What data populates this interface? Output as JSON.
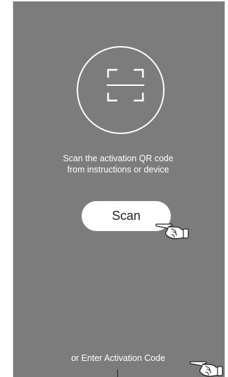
{
  "instructions": {
    "line1": "Scan the activation QR code",
    "line2": "from instructions or device"
  },
  "scan_button": {
    "label": "Scan"
  },
  "enter_code": {
    "label": "or Enter Activation Code"
  },
  "icons": {
    "scan_frame": "qr-scan-frame-icon",
    "pointer_hand": "pointing-hand-icon"
  },
  "colors": {
    "background": "#7c7c7c",
    "foreground": "#ffffff"
  }
}
